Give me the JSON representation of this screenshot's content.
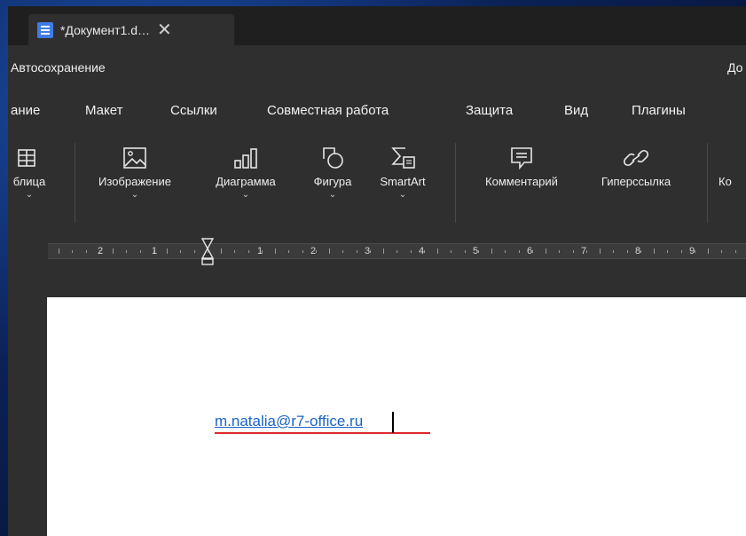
{
  "tab": {
    "title": "*Документ1.d…",
    "close_glyph": "✕"
  },
  "titlebar": {
    "autosave_label": "Автосохранение",
    "document_name_partial": "До"
  },
  "menu": {
    "items": [
      "ание",
      "Макет",
      "Ссылки",
      "Совместная работа",
      "Защита",
      "Вид",
      "Плагины"
    ]
  },
  "toolbar": {
    "table_label": "блица",
    "image_label": "Изображение",
    "chart_label": "Диаграмма",
    "shape_label": "Фигура",
    "smartart_label": "SmartArt",
    "comment_label": "Комментарий",
    "hyperlink_label": "Гиперссылка",
    "next_label_partial": "Ко"
  },
  "ruler": {
    "labels": [
      "2",
      "1",
      "1",
      "2",
      "3",
      "4",
      "5",
      "6",
      "7",
      "8",
      "9"
    ]
  },
  "document": {
    "link_text": "m.natalia@r7-office.ru",
    "link_color": "#1a64c8"
  },
  "colors": {
    "accent": "#3f7ce4",
    "annotation_arrow": "#e0262a"
  },
  "icons": {
    "table": "table-icon",
    "image": "image-icon",
    "chart": "chart-icon",
    "shape": "shape-icon",
    "smartart": "smartart-icon",
    "comment": "comment-icon",
    "hyperlink": "hyperlink-icon",
    "chevron": "chevron-down-icon"
  }
}
